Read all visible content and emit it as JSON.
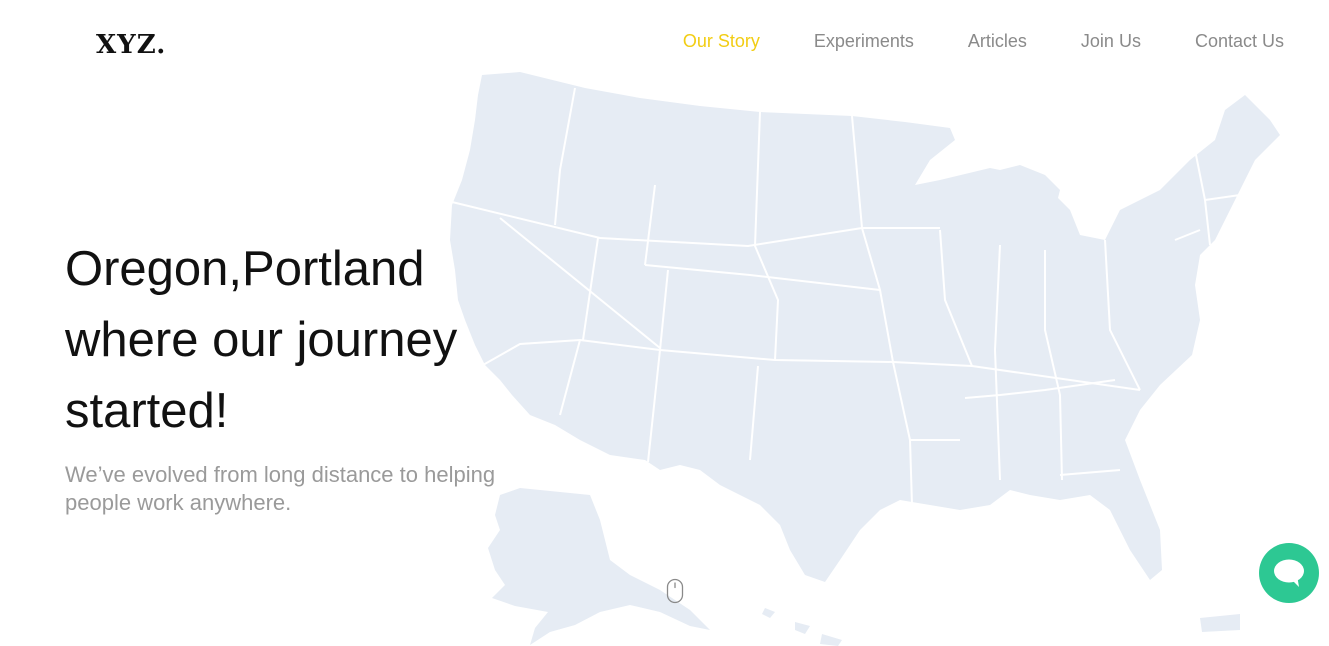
{
  "brand": {
    "logo_text": "XYZ."
  },
  "nav": {
    "items": [
      {
        "label": "Our Story",
        "active": true
      },
      {
        "label": "Experiments",
        "active": false
      },
      {
        "label": "Articles",
        "active": false
      },
      {
        "label": "Join Us",
        "active": false
      },
      {
        "label": "Contact Us",
        "active": false
      }
    ]
  },
  "hero": {
    "title_line1": "Oregon,Portland",
    "title_line2": "where our journey",
    "title_line3": "started!",
    "subtitle_line1": "We’ve evolved from long distance to helping",
    "subtitle_line2": "people work anywhere."
  },
  "icons": {
    "map": "us-map-illustration",
    "scroll": "mouse-scroll-icon",
    "chat": "chat-bubble-icon"
  },
  "colors": {
    "accent": "#f2cd14",
    "nav_text": "#8a8a8a",
    "map_fill": "#e6ecf4",
    "chat_button": "#2dc893"
  }
}
